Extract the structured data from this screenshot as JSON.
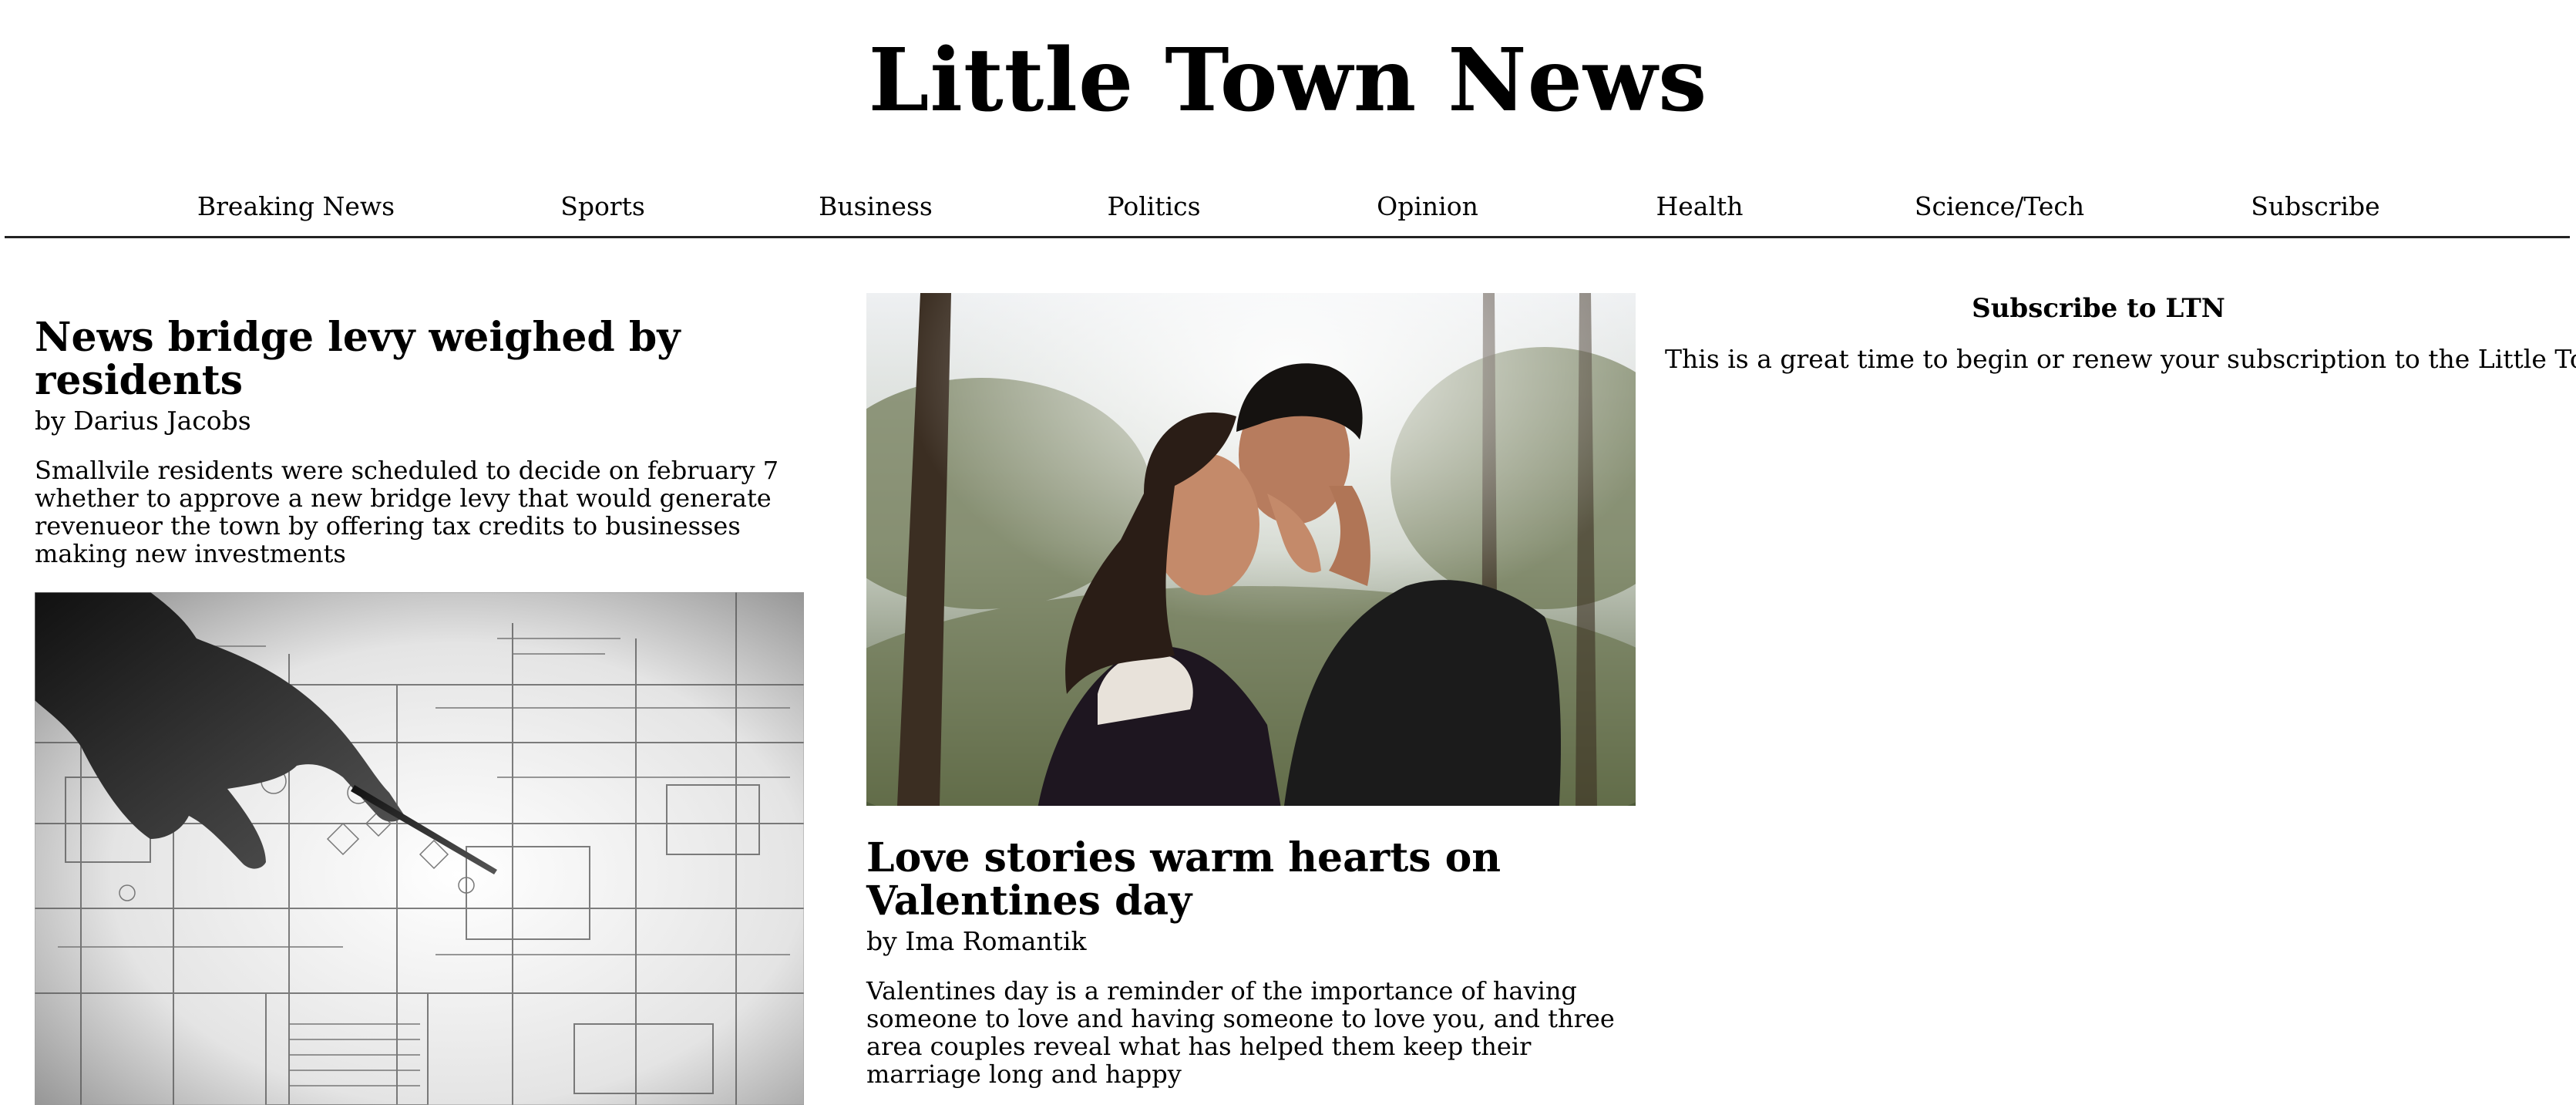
{
  "masthead": {
    "title": "Little Town News"
  },
  "nav": {
    "items": [
      {
        "label": "Breaking News"
      },
      {
        "label": "Sports"
      },
      {
        "label": "Business"
      },
      {
        "label": "Politics"
      },
      {
        "label": "Opinion"
      },
      {
        "label": "Health"
      },
      {
        "label": "Science/Tech"
      },
      {
        "label": "Subscribe"
      }
    ]
  },
  "articles": [
    {
      "headline": "News bridge levy weighed by residents",
      "byline": "by Darius Jacobs",
      "summary": "Smallvile residents were scheduled to decide on february 7 whether to approve a new bridge levy that would generate revenueor the town by offering tax credits to businesses making new investments",
      "image": "blueprint-photo"
    },
    {
      "headline": "Love stories warm hearts on Valentines day",
      "byline": "by Ima Romantik",
      "summary": "Valentines day is a reminder of the importance of having someone to love and having someone to love you, and three area couples reveal what has helped them keep their marriage long and happy",
      "image": "couple-photo"
    }
  ],
  "sidebar": {
    "title": "Subscribe to LTN",
    "text": "This is a great time to begin or renew your subscription to the Little Town News"
  },
  "colors": {
    "text": "#000000",
    "background": "#ffffff",
    "rule": "#222222"
  }
}
